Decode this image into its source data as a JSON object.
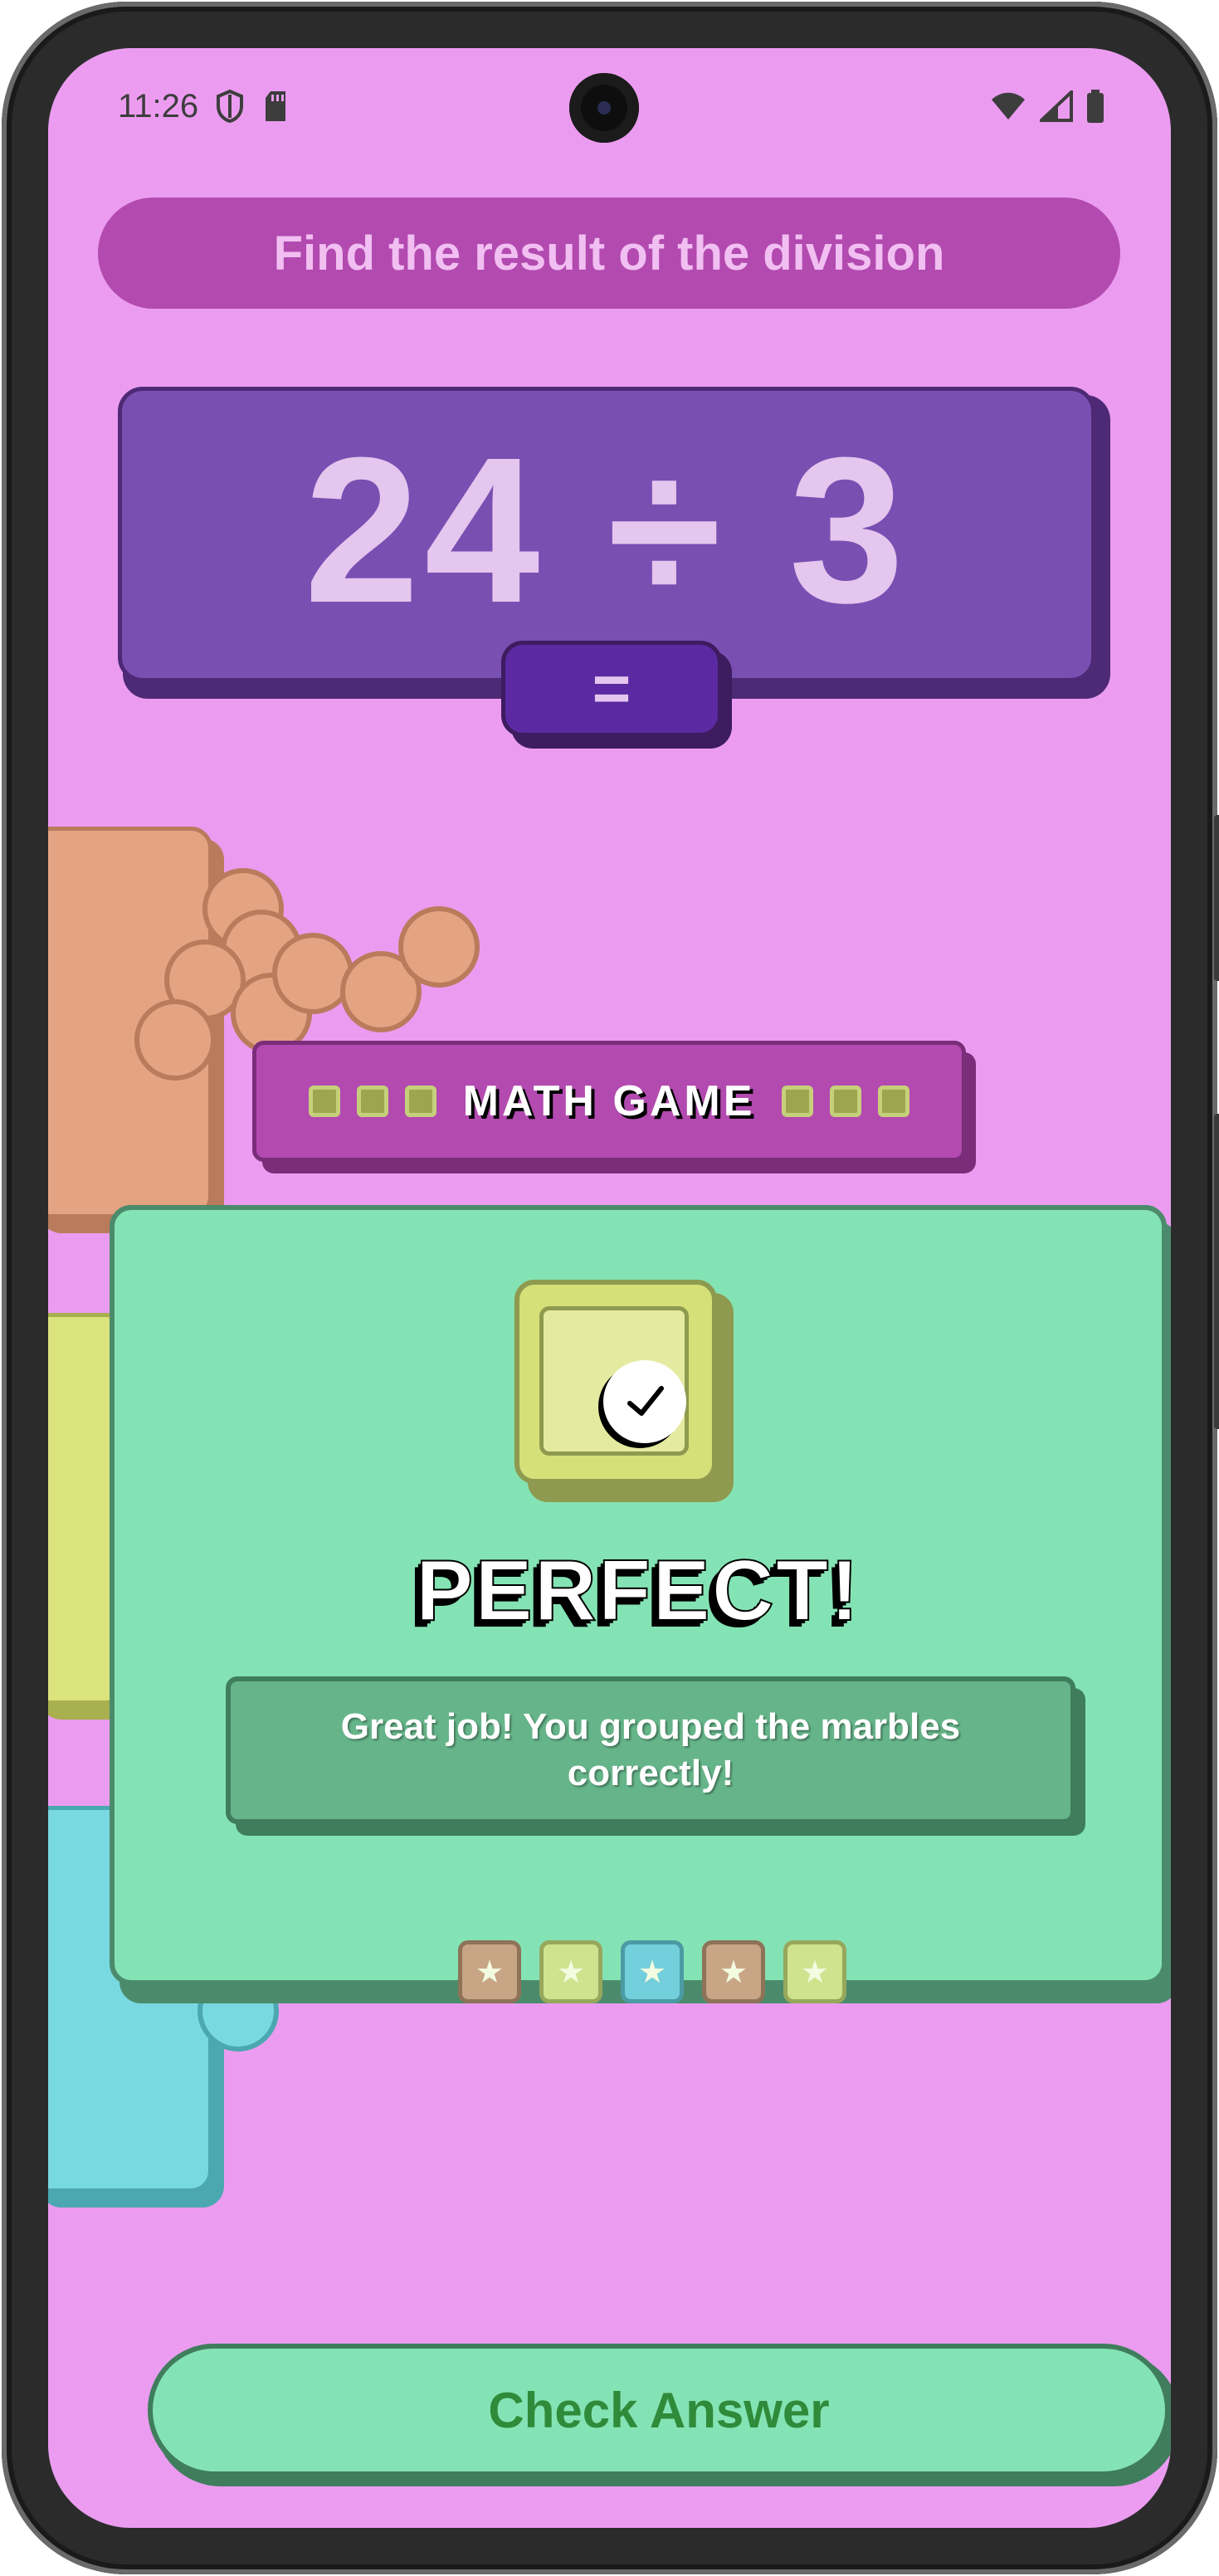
{
  "status_bar": {
    "time": "11:26",
    "left_icons": [
      "shield-icon",
      "sd-card-icon"
    ],
    "right_icons": [
      "wifi-icon",
      "cell-signal-icon",
      "battery-icon"
    ]
  },
  "instruction": "Find the result of the division",
  "equation": {
    "text": "24 ÷ 3",
    "equals": "="
  },
  "game_label": "MATH GAME",
  "result_card": {
    "icon": "check-icon",
    "heading": "PERFECT!",
    "message": "Great job! You grouped the marbles correctly!",
    "stars": [
      {
        "icon": "star-icon",
        "color": "#c7a585"
      },
      {
        "icon": "star-icon",
        "color": "#cfe38e"
      },
      {
        "icon": "star-icon",
        "color": "#73cfdb"
      },
      {
        "icon": "star-icon",
        "color": "#c7a585"
      },
      {
        "icon": "star-icon",
        "color": "#cfe38e"
      }
    ]
  },
  "check_button": "Check Answer",
  "colors": {
    "background": "#eb9cf0",
    "banner": "#b34ab0",
    "equation_box": "#7a4fb2",
    "card": "#84e3b4",
    "button_text": "#2f8a3a"
  }
}
